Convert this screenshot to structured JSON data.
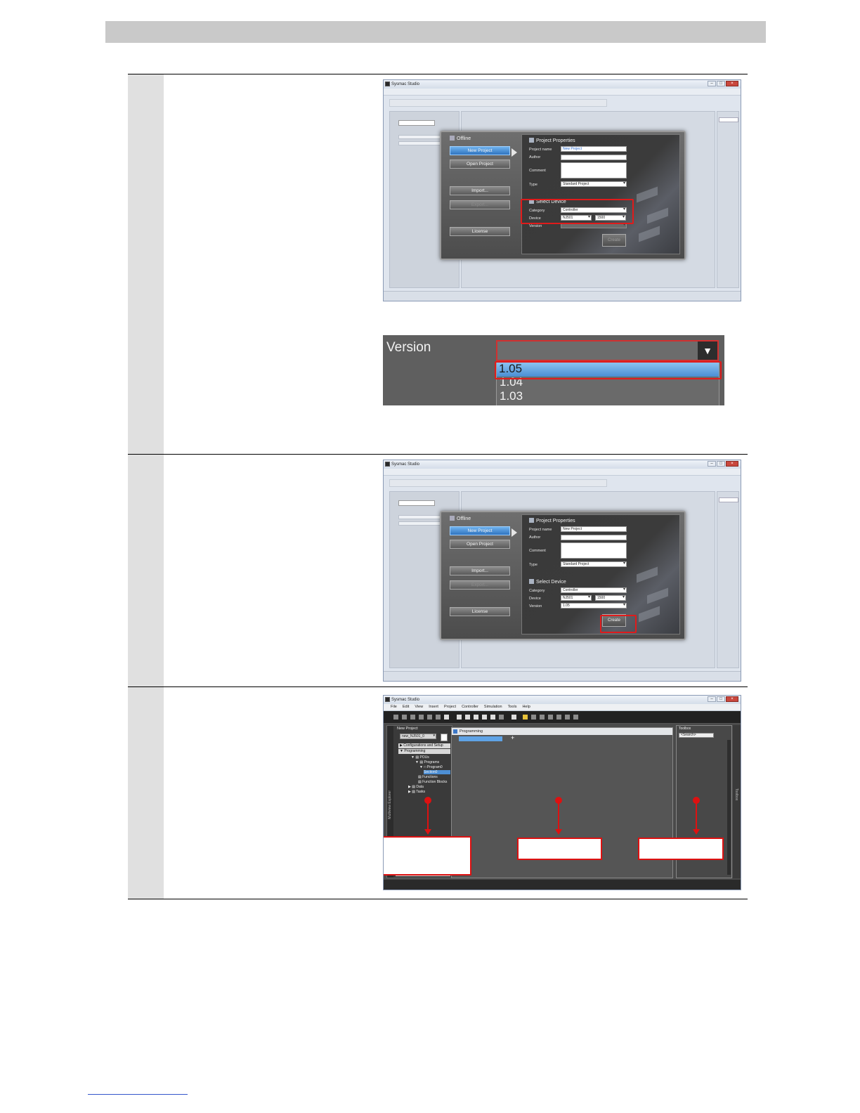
{
  "steps": [
    {
      "window": {
        "title": "Sysmac Studio",
        "dialog": {
          "offline_label": "Offline",
          "buttons": [
            "New Project",
            "Open Project",
            "Import...",
            "Export...",
            "License"
          ],
          "project_properties_label": "Project Properties",
          "project_name_label": "Project name",
          "project_name_value": "New Project",
          "author_label": "Author",
          "comment_label": "Comment",
          "type_label": "Type",
          "type_value": "Standard Project",
          "select_device_label": "Select Device",
          "category_label": "Category",
          "category_value": "Controller",
          "device_label": "Device",
          "device_value_1": "NJ501",
          "device_value_2": "1500",
          "version_label": "Version",
          "version_value": "",
          "create_label": "Create"
        }
      },
      "version_zoom": {
        "label": "Version",
        "options": [
          "1.05",
          "1.04",
          "1.03"
        ],
        "selected": "1.05"
      }
    },
    {
      "window": {
        "title": "Sysmac Studio",
        "dialog": {
          "offline_label": "Offline",
          "buttons": [
            "New Project",
            "Open Project",
            "Import...",
            "Export...",
            "License"
          ],
          "project_properties_label": "Project Properties",
          "project_name_label": "Project name",
          "project_name_value": "New Project",
          "author_label": "Author",
          "comment_label": "Comment",
          "type_label": "Type",
          "type_value": "Standard Project",
          "select_device_label": "Select Device",
          "category_label": "Category",
          "category_value": "Controller",
          "device_label": "Device",
          "device_value_1": "NJ501",
          "device_value_2": "1500",
          "version_label": "Version",
          "version_value": "1.05",
          "create_label": "Create"
        }
      }
    },
    {
      "window": {
        "title": "Sysmac Studio",
        "menu": [
          "File",
          "Edit",
          "View",
          "Insert",
          "Project",
          "Controller",
          "Simulation",
          "Tools",
          "Help"
        ],
        "multiview": {
          "title": "New Project",
          "selector": "new_NJ501_0",
          "side_label": "Multiview Explorer",
          "tree": [
            "Configurations and Setup",
            "Programming",
            "POUs",
            "Programs",
            "Program0",
            "Section0",
            "Functions",
            "Function Blocks",
            "Data",
            "Tasks"
          ]
        },
        "programming": {
          "title": "Programming"
        },
        "toolbox": {
          "title": "Toolbox",
          "search": "<Search>",
          "side_label": "Toolbox"
        }
      }
    }
  ]
}
